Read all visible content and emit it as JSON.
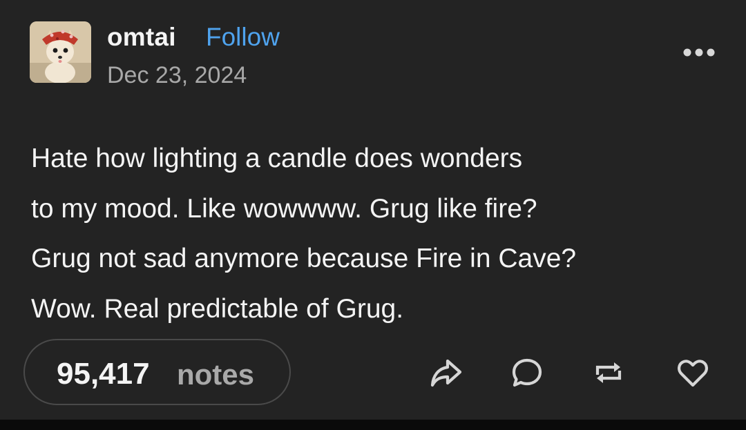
{
  "post": {
    "author": {
      "username": "omtai",
      "follow_label": "Follow",
      "avatar": "chihuahua-avatar"
    },
    "date": "Dec 23, 2024",
    "more_icon": "more-horizontal-icon",
    "text_lines": [
      "Hate how lighting a candle does wonders",
      "to my mood. Like wowwww. Grug like fire?",
      "Grug not sad anymore because Fire in Cave?",
      "Wow. Real predictable of Grug."
    ],
    "notes": {
      "count": "95,417",
      "label": "notes"
    },
    "actions": [
      {
        "name": "share",
        "icon": "share-arrow-icon"
      },
      {
        "name": "reply",
        "icon": "comment-bubble-icon"
      },
      {
        "name": "reblog",
        "icon": "reblog-icon"
      },
      {
        "name": "like",
        "icon": "heart-icon"
      }
    ]
  },
  "colors": {
    "background": "#232323",
    "text": "#f4f4f4",
    "muted": "#a8a8a8",
    "link": "#4fa3ee",
    "border": "#4a4a4a"
  }
}
